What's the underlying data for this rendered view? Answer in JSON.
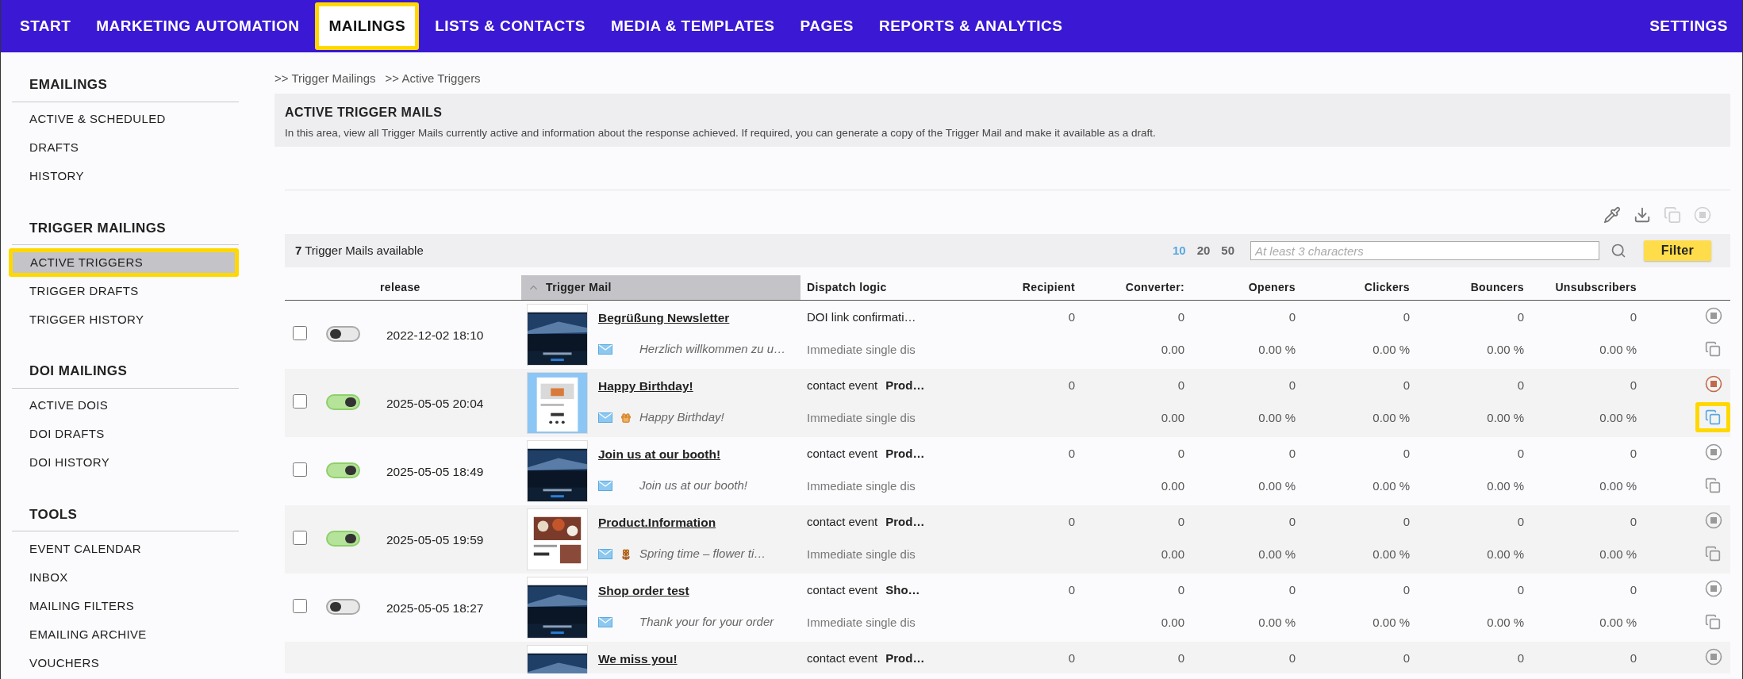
{
  "nav": {
    "items": [
      {
        "label": "START",
        "selected": false,
        "highlighted": false
      },
      {
        "label": "MARKETING AUTOMATION",
        "selected": false,
        "highlighted": false
      },
      {
        "label": "MAILINGS",
        "selected": true,
        "highlighted": true
      },
      {
        "label": "LISTS & CONTACTS",
        "selected": false,
        "highlighted": false
      },
      {
        "label": "MEDIA & TEMPLATES",
        "selected": false,
        "highlighted": false
      },
      {
        "label": "PAGES",
        "selected": false,
        "highlighted": false
      },
      {
        "label": "REPORTS & ANALYTICS",
        "selected": false,
        "highlighted": false
      }
    ],
    "settings": "SETTINGS"
  },
  "sidebar": {
    "sections": [
      {
        "title": "EMAILINGS",
        "items": [
          {
            "label": "ACTIVE & SCHEDULED",
            "selected": false,
            "highlighted": false
          },
          {
            "label": "DRAFTS",
            "selected": false,
            "highlighted": false
          },
          {
            "label": "HISTORY",
            "selected": false,
            "highlighted": false
          }
        ]
      },
      {
        "title": "TRIGGER MAILINGS",
        "items": [
          {
            "label": "ACTIVE TRIGGERS",
            "selected": true,
            "highlighted": true
          },
          {
            "label": "TRIGGER DRAFTS",
            "selected": false,
            "highlighted": false
          },
          {
            "label": "TRIGGER HISTORY",
            "selected": false,
            "highlighted": false
          }
        ]
      },
      {
        "title": "DOI MAILINGS",
        "items": [
          {
            "label": "ACTIVE DOIS",
            "selected": false,
            "highlighted": false
          },
          {
            "label": "DOI DRAFTS",
            "selected": false,
            "highlighted": false
          },
          {
            "label": "DOI HISTORY",
            "selected": false,
            "highlighted": false
          }
        ]
      },
      {
        "title": "TOOLS",
        "items": [
          {
            "label": "EVENT CALENDAR",
            "selected": false,
            "highlighted": false
          },
          {
            "label": "INBOX",
            "selected": false,
            "highlighted": false
          },
          {
            "label": "MAILING FILTERS",
            "selected": false,
            "highlighted": false
          },
          {
            "label": "EMAILING ARCHIVE",
            "selected": false,
            "highlighted": false
          },
          {
            "label": "VOUCHERS",
            "selected": false,
            "highlighted": false
          }
        ]
      }
    ]
  },
  "breadcrumb": [
    ">> Trigger Mailings",
    ">> Active Triggers"
  ],
  "header": {
    "title": "ACTIVE TRIGGER MAILS",
    "description": "In this area, view all Trigger Mails currently active and information about the response achieved. If required, you can generate a copy of the Trigger Mail and make it available as a draft."
  },
  "toolbar": [
    {
      "kind": "pipette",
      "disabled": false
    },
    {
      "kind": "download",
      "disabled": false
    },
    {
      "kind": "copy",
      "disabled": true
    },
    {
      "kind": "stop",
      "disabled": true
    }
  ],
  "list_bar": {
    "count": "7",
    "count_label": "Trigger Mails available",
    "page_sizes": [
      {
        "label": "10",
        "selected": true
      },
      {
        "label": "20",
        "selected": false
      },
      {
        "label": "50",
        "selected": false
      }
    ],
    "search": {
      "placeholder": "At least 3 characters"
    },
    "filter_button": "Filter"
  },
  "table": {
    "columns": [
      {
        "label": "release",
        "sorted": false
      },
      {
        "label": "Trigger Mail",
        "sorted": true
      },
      {
        "label": "Dispatch logic",
        "sorted": false
      },
      {
        "label": "Recipient",
        "sorted": false
      },
      {
        "label": "Converter:",
        "sorted": false
      },
      {
        "label": "Openers",
        "sorted": false
      },
      {
        "label": "Clickers",
        "sorted": false
      },
      {
        "label": "Bouncers",
        "sorted": false
      },
      {
        "label": "Unsubscribers",
        "sorted": false
      }
    ],
    "rows": [
      {
        "checked": false,
        "on": false,
        "hovered": false,
        "copy_highlighted": false,
        "release": "2022-12-02 18:10",
        "thumbnail": {
          "kind": "picture"
        },
        "title": "Begrüßung Newsletter",
        "subject": "Herzlich willkommen zu u…",
        "dispatch_event": "DOI link confirmati…",
        "dispatch_mode": "Immediate single dis",
        "stats": [
          {
            "count": "0"
          },
          {
            "count": "0",
            "rate": "0.00"
          },
          {
            "count": "0",
            "rate": "0.00 %"
          },
          {
            "count": "0",
            "rate": "0.00 %"
          },
          {
            "count": "0",
            "rate": "0.00 %"
          },
          {
            "count": "0",
            "rate": "0.00 %"
          }
        ]
      },
      {
        "checked": false,
        "on": true,
        "hovered": true,
        "copy_highlighted": true,
        "release": "2025-05-05 20:04",
        "thumbnail": {
          "kind": "picture"
        },
        "title": "Happy Birthday!",
        "subject_icon": {
          "kind": "gift"
        },
        "subject": "Happy Birthday!",
        "dispatch_event": "contact event",
        "dispatch_target": "Prod…",
        "dispatch_mode": "Immediate single dis",
        "stats": [
          {
            "count": "0"
          },
          {
            "count": "0",
            "rate": "0.00"
          },
          {
            "count": "0",
            "rate": "0.00 %"
          },
          {
            "count": "0",
            "rate": "0.00 %"
          },
          {
            "count": "0",
            "rate": "0.00 %"
          },
          {
            "count": "0",
            "rate": "0.00 %"
          }
        ]
      },
      {
        "checked": false,
        "on": true,
        "hovered": false,
        "copy_highlighted": false,
        "release": "2025-05-05 18:49",
        "thumbnail": {
          "kind": "picture"
        },
        "title": "Join us at our booth!",
        "subject": "Join us at our booth!",
        "dispatch_event": "contact event",
        "dispatch_target": "Prod…",
        "dispatch_mode": "Immediate single dis",
        "stats": [
          {
            "count": "0"
          },
          {
            "count": "0",
            "rate": "0.00"
          },
          {
            "count": "0",
            "rate": "0.00 %"
          },
          {
            "count": "0",
            "rate": "0.00 %"
          },
          {
            "count": "0",
            "rate": "0.00 %"
          },
          {
            "count": "0",
            "rate": "0.00 %"
          }
        ]
      },
      {
        "checked": false,
        "on": true,
        "hovered": false,
        "copy_highlighted": false,
        "release": "2025-05-05 19:59",
        "thumbnail": {
          "kind": "picture"
        },
        "title": "Product.Information",
        "subject_icon": {
          "kind": "flower"
        },
        "subject": "Spring time – flower ti…",
        "dispatch_event": "contact event",
        "dispatch_target": "Prod…",
        "dispatch_mode": "Immediate single dis",
        "stats": [
          {
            "count": "0"
          },
          {
            "count": "0",
            "rate": "0.00"
          },
          {
            "count": "0",
            "rate": "0.00 %"
          },
          {
            "count": "0",
            "rate": "0.00 %"
          },
          {
            "count": "0",
            "rate": "0.00 %"
          },
          {
            "count": "0",
            "rate": "0.00 %"
          }
        ]
      },
      {
        "checked": false,
        "on": false,
        "hovered": false,
        "copy_highlighted": false,
        "release": "2025-05-05 18:27",
        "thumbnail": {
          "kind": "picture"
        },
        "title": "Shop order test",
        "subject": "Thank your for your order",
        "dispatch_event": "contact event",
        "dispatch_target": "Sho…",
        "dispatch_mode": "Immediate single dis",
        "stats": [
          {
            "count": "0"
          },
          {
            "count": "0",
            "rate": "0.00"
          },
          {
            "count": "0",
            "rate": "0.00 %"
          },
          {
            "count": "0",
            "rate": "0.00 %"
          },
          {
            "count": "0",
            "rate": "0.00 %"
          },
          {
            "count": "0",
            "rate": "0.00 %"
          }
        ]
      },
      {
        "partial": true,
        "hovered": false,
        "thumbnail": {
          "kind": "picture"
        },
        "title": "We miss you!",
        "dispatch_event": "contact event",
        "dispatch_target": "Prod…",
        "stats": [
          {
            "count": "0"
          },
          {
            "count": "0"
          },
          {
            "count": "0"
          },
          {
            "count": "0"
          },
          {
            "count": "0"
          },
          {
            "count": "0"
          }
        ]
      }
    ]
  }
}
